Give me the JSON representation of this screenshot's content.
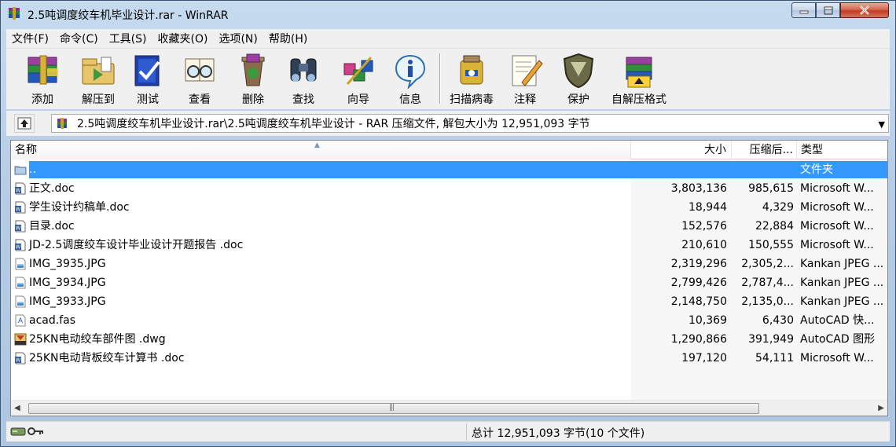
{
  "window": {
    "title": "2.5吨调度绞车机毕业设计.rar - WinRAR",
    "controls": [
      "minimize",
      "maximize",
      "close"
    ]
  },
  "menu": [
    "文件(F)",
    "命令(C)",
    "工具(S)",
    "收藏夹(O)",
    "选项(N)",
    "帮助(H)"
  ],
  "toolbar": [
    {
      "label": "添加",
      "icon": "add-archive-icon"
    },
    {
      "label": "解压到",
      "icon": "extract-to-icon"
    },
    {
      "label": "测试",
      "icon": "test-icon"
    },
    {
      "label": "查看",
      "icon": "view-icon"
    },
    {
      "label": "删除",
      "icon": "delete-icon"
    },
    {
      "label": "查找",
      "icon": "find-icon"
    },
    {
      "label": "向导",
      "icon": "wizard-icon"
    },
    {
      "label": "信息",
      "icon": "info-icon"
    },
    {
      "label": "扫描病毒",
      "icon": "virus-scan-icon"
    },
    {
      "label": "注释",
      "icon": "comment-icon"
    },
    {
      "label": "保护",
      "icon": "protect-icon"
    },
    {
      "label": "自解压格式",
      "icon": "sfx-icon"
    }
  ],
  "address": {
    "path": "2.5吨调度绞车机毕业设计.rar\\2.5吨调度绞车机毕业设计 - RAR 压缩文件, 解包大小为 12,951,093 字节"
  },
  "columns": {
    "name": "名称",
    "size": "大小",
    "packed": "压缩后...",
    "type": "类型"
  },
  "files": [
    {
      "name": "..",
      "size": "",
      "packed": "",
      "type": "文件夹",
      "icon": "folder-up-icon",
      "selected": true
    },
    {
      "name": "正文.doc",
      "size": "3,803,136",
      "packed": "985,615",
      "type": "Microsoft W...",
      "icon": "word-doc-icon"
    },
    {
      "name": "学生设计约稿单.doc",
      "size": "18,944",
      "packed": "4,329",
      "type": "Microsoft W...",
      "icon": "word-doc-icon"
    },
    {
      "name": "目录.doc",
      "size": "152,576",
      "packed": "22,884",
      "type": "Microsoft W...",
      "icon": "word-doc-icon"
    },
    {
      "name": "JD-2.5调度绞车设计毕业设计开题报告 .doc",
      "size": "210,610",
      "packed": "150,555",
      "type": "Microsoft W...",
      "icon": "word-doc-icon"
    },
    {
      "name": "IMG_3935.JPG",
      "size": "2,319,296",
      "packed": "2,305,2...",
      "type": "Kankan JPEG ...",
      "icon": "jpeg-icon"
    },
    {
      "name": "IMG_3934.JPG",
      "size": "2,799,426",
      "packed": "2,787,4...",
      "type": "Kankan JPEG ...",
      "icon": "jpeg-icon"
    },
    {
      "name": "IMG_3933.JPG",
      "size": "2,148,750",
      "packed": "2,135,0...",
      "type": "Kankan JPEG ...",
      "icon": "jpeg-icon"
    },
    {
      "name": "acad.fas",
      "size": "10,369",
      "packed": "6,430",
      "type": "AutoCAD 快...",
      "icon": "fas-file-icon"
    },
    {
      "name": "25KN电动绞车部件图 .dwg",
      "size": "1,290,866",
      "packed": "391,949",
      "type": "AutoCAD 图形",
      "icon": "dwg-file-icon"
    },
    {
      "name": "25KN电动背板绞车计算书 .doc",
      "size": "197,120",
      "packed": "54,111",
      "type": "Microsoft W...",
      "icon": "word-doc-icon"
    }
  ],
  "status": {
    "text": "总计 12,951,093 字节(10 个文件)"
  },
  "colors": {
    "selection": "#3399ff",
    "chrome": "#f0f0f0"
  }
}
